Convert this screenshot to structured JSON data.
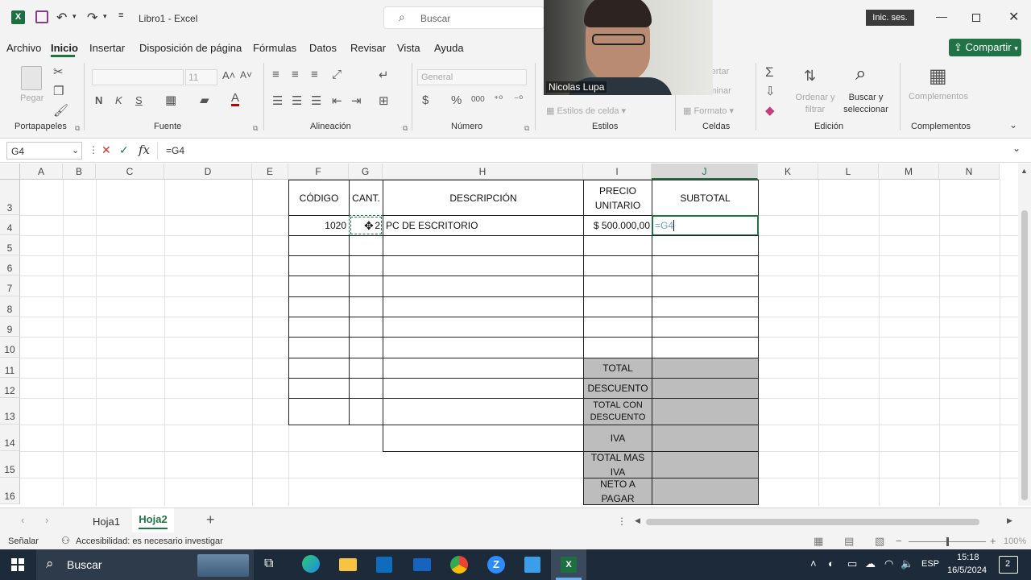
{
  "title_bar": {
    "doc_title": "Libro1 - Excel",
    "search_placeholder": "Buscar",
    "signin_label": "Inic. ses."
  },
  "menu": {
    "items": [
      "Archivo",
      "Inicio",
      "Insertar",
      "Disposición de página",
      "Fórmulas",
      "Datos",
      "Revisar",
      "Vista",
      "Ayuda"
    ],
    "active": "Inicio",
    "share_label": "Compartir"
  },
  "ribbon": {
    "groups": [
      "Portapapeles",
      "Fuente",
      "Alineación",
      "Número",
      "Estilos",
      "Celdas",
      "Edición",
      "Complementos"
    ],
    "paste_label": "Pegar",
    "font_size": "11",
    "number_format": "General",
    "styles_label": "Estilos de celda",
    "format_label": "Formato",
    "insert_label": "Insertar",
    "delete_label": "Eliminar",
    "sort_label": "Ordenar y filtrar",
    "find_label": "Buscar y seleccionar",
    "addins_label": "Complementos"
  },
  "formula_bar": {
    "name_box": "G4",
    "formula": "=G4"
  },
  "webcam": {
    "participant_name": "Nicolas Lupa"
  },
  "sheet": {
    "columns": [
      "A",
      "B",
      "C",
      "D",
      "E",
      "F",
      "G",
      "H",
      "I",
      "J",
      "K",
      "L",
      "M",
      "N"
    ],
    "selected_column": "J",
    "rows": [
      "3",
      "4",
      "5",
      "6",
      "7",
      "8",
      "9",
      "10",
      "11",
      "12",
      "13",
      "14",
      "15",
      "16"
    ],
    "headers": {
      "codigo": "CÓDIGO",
      "cant": "CANT.",
      "descripcion": "DESCRIPCIÓN",
      "precio": "PRECIO UNITARIO",
      "subtotal": "SUBTOTAL"
    },
    "row4": {
      "codigo": "1020",
      "cant": "2",
      "descripcion": "PC DE ESCRITORIO",
      "precio": "$ 500.000,00",
      "subtotal_edit": "=G4"
    },
    "summary": {
      "total": "TOTAL",
      "descuento": "DESCUENTO",
      "total_con_descuento": "TOTAL CON DESCUENTO",
      "iva": "IVA",
      "total_mas_iva": "TOTAL MAS IVA",
      "neto_a_pagar": "NETO A PAGAR"
    }
  },
  "sheet_tabs": {
    "tabs": [
      "Hoja1",
      "Hoja2"
    ],
    "active": "Hoja2"
  },
  "status_bar": {
    "mode": "Señalar",
    "accessibility": "Accesibilidad: es necesario investigar",
    "zoom": "100%"
  },
  "taskbar": {
    "search_label": "Buscar",
    "language": "ESP",
    "time": "15:18",
    "date": "16/5/2024",
    "notifications": "2"
  },
  "colors": {
    "excel_green": "#217346",
    "summary_fill": "#bdbdbd",
    "taskbar": "#1c2a3a"
  }
}
